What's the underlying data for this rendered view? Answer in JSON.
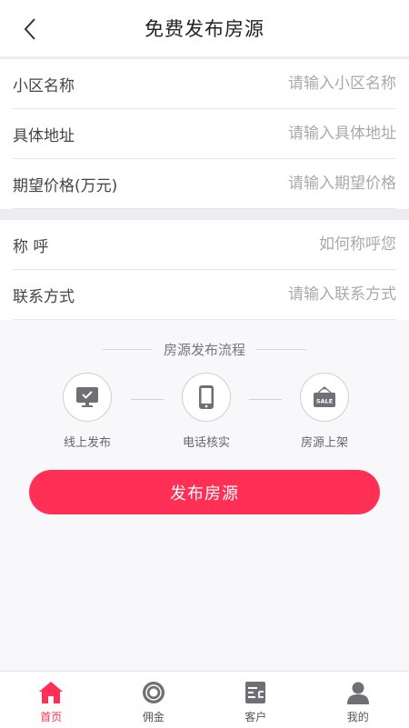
{
  "header": {
    "title": "免费发布房源"
  },
  "form_group1": [
    {
      "label": "小区名称",
      "placeholder": "请输入小区名称",
      "value": ""
    },
    {
      "label": "具体地址",
      "placeholder": "请输入具体地址",
      "value": ""
    },
    {
      "label": "期望价格(万元)",
      "placeholder": "请输入期望价格",
      "value": ""
    }
  ],
  "form_group2": [
    {
      "label": "称 呼",
      "placeholder": "如何称呼您",
      "value": ""
    },
    {
      "label": "联系方式",
      "placeholder": "请输入联系方式",
      "value": ""
    }
  ],
  "process": {
    "title": "房源发布流程",
    "steps": [
      {
        "label": "线上发布",
        "icon": "monitor-icon"
      },
      {
        "label": "电话核实",
        "icon": "phone-icon"
      },
      {
        "label": "房源上架",
        "icon": "sale-tag-icon",
        "icon_text": "SALE"
      }
    ]
  },
  "publish_button": {
    "label": "发布房源"
  },
  "tabbar": [
    {
      "label": "首页",
      "icon": "home-icon",
      "active": true
    },
    {
      "label": "佣金",
      "icon": "coin-icon",
      "active": false
    },
    {
      "label": "客户",
      "icon": "client-card-icon",
      "active": false
    },
    {
      "label": "我的",
      "icon": "user-icon",
      "active": false
    }
  ],
  "colors": {
    "accent": "#ff2f55",
    "icon_gray": "#6f6f75",
    "divider": "#e6e6e9"
  }
}
